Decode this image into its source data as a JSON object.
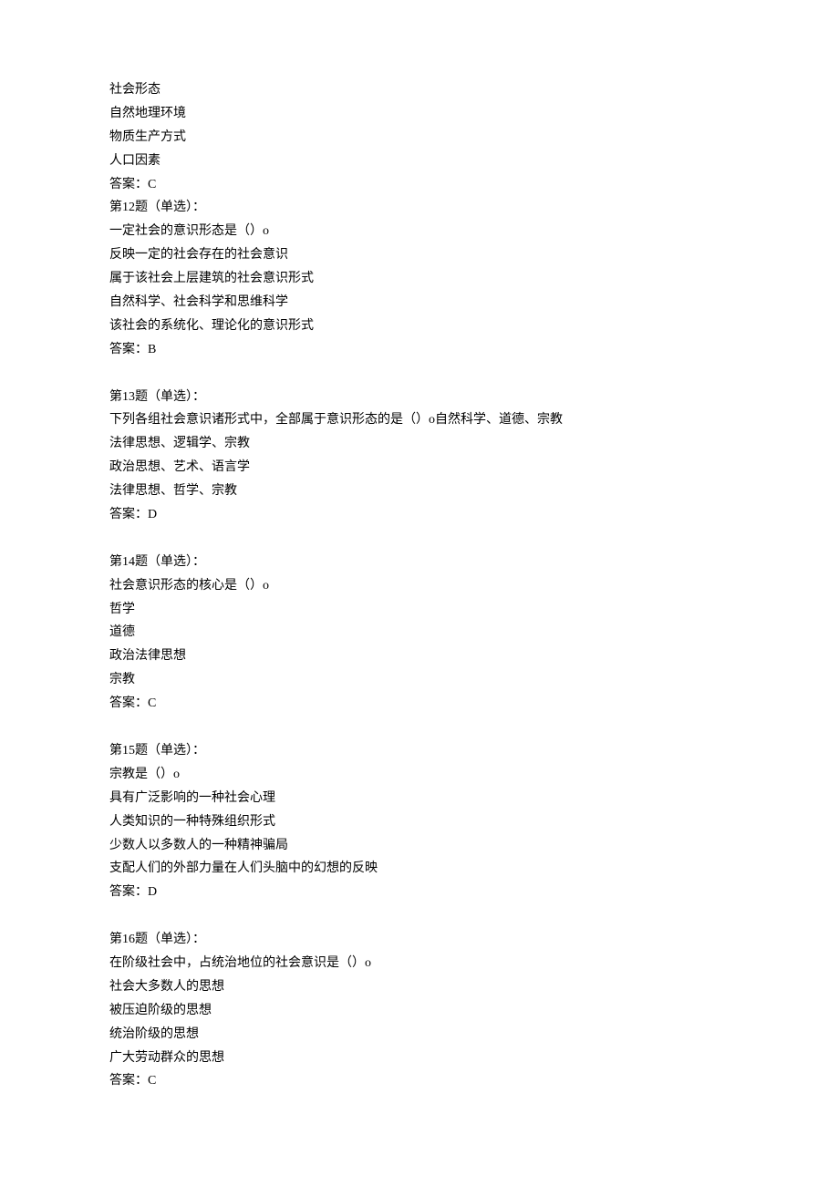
{
  "intro_lines": [
    "社会形态",
    "自然地理环境",
    "物质生产方式",
    "人口因素",
    "答案：C"
  ],
  "questions": [
    {
      "header": "第12题（单选）：",
      "stem": "一定社会的意识形态是（）o",
      "options": [
        "反映一定的社会存在的社会意识",
        "属于该社会上层建筑的社会意识形式",
        "自然科学、社会科学和思维科学",
        "该社会的系统化、理论化的意识形式"
      ],
      "answer": "答案：B"
    },
    {
      "header": "第13题（单选）：",
      "stem": "下列各组社会意识诸形式中，全部属于意识形态的是（）o自然科学、道德、宗教",
      "options": [
        "法律思想、逻辑学、宗教",
        "政治思想、艺术、语言学",
        "法律思想、哲学、宗教"
      ],
      "answer": "答案：D"
    },
    {
      "header": "第14题（单选）：",
      "stem": "社会意识形态的核心是（）o",
      "options": [
        "哲学",
        "道德",
        "政治法律思想",
        "宗教"
      ],
      "answer": "答案：C"
    },
    {
      "header": "第15题（单选）：",
      "stem": "宗教是（）o",
      "options": [
        "具有广泛影响的一种社会心理",
        "人类知识的一种特殊组织形式",
        "少数人以多数人的一种精神骗局",
        "支配人们的外部力量在人们头脑中的幻想的反映"
      ],
      "answer": "答案：D"
    },
    {
      "header": "第16题（单选）：",
      "stem": "在阶级社会中，占统治地位的社会意识是（）o",
      "options": [
        "社会大多数人的思想",
        "被压迫阶级的思想",
        "统治阶级的思想",
        "广大劳动群众的思想"
      ],
      "answer": "答案：C"
    }
  ]
}
